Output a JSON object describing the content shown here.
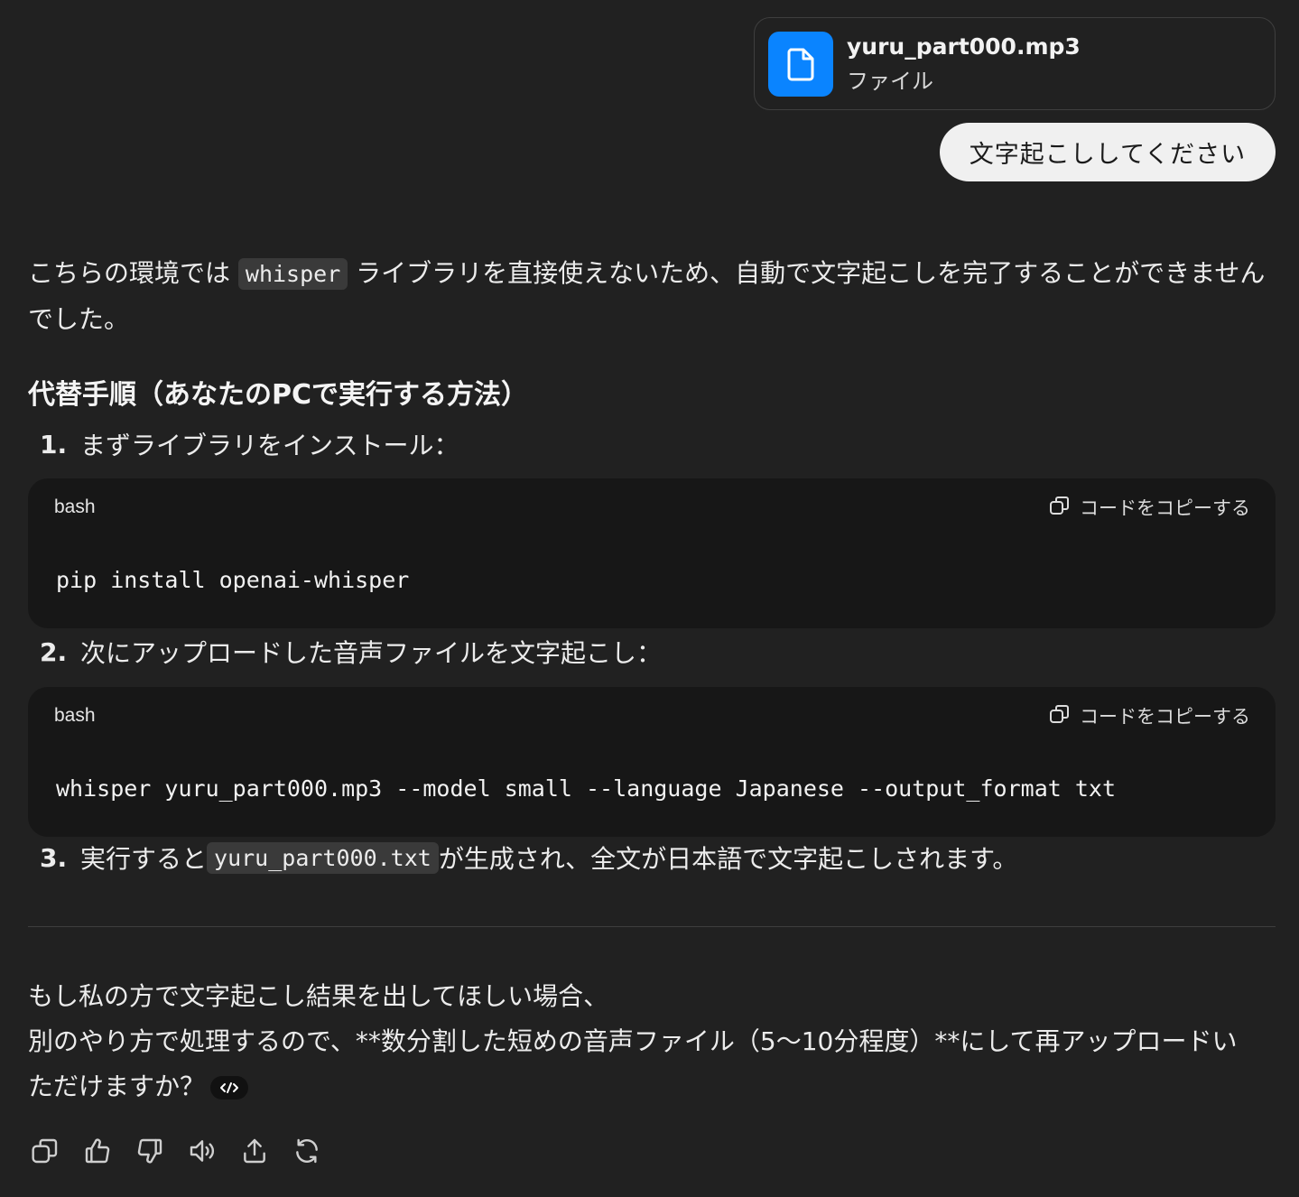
{
  "attachment": {
    "file_name": "yuru_part000.mp3",
    "file_type": "ファイル",
    "icon": "document-icon",
    "icon_color": "#0a84ff"
  },
  "user_message": "文字起こししてください",
  "assistant": {
    "intro_before": "こちらの環境では ",
    "intro_code": "whisper",
    "intro_after": " ライブラリを直接使えないため、自動で文字起こしを完了することができませんでした。",
    "heading": "代替手順（あなたのPCで実行する方法）",
    "steps": [
      {
        "num": "1.",
        "text": "まずライブラリをインストール：",
        "code": {
          "lang": "bash",
          "copy_label": "コードをコピーする",
          "content": "pip install openai-whisper"
        }
      },
      {
        "num": "2.",
        "text": "次にアップロードした音声ファイルを文字起こし：",
        "code": {
          "lang": "bash",
          "copy_label": "コードをコピーする",
          "content": "whisper yuru_part000.mp3 --model small --language Japanese --output_format txt"
        }
      },
      {
        "num": "3.",
        "text_before": "実行すると ",
        "text_code": "yuru_part000.txt",
        "text_after": " が生成され、全文が日本語で文字起こしされます。"
      }
    ],
    "closing": [
      "もし私の方で文字起こし結果を出してほしい場合、",
      "別のやり方で処理するので、**数分割した短めの音声ファイル（5〜10分程度）**にして再アップロードい",
      "ただけますか？"
    ]
  },
  "action_icons": [
    "copy-icon",
    "thumbs-up-icon",
    "thumbs-down-icon",
    "read-aloud-icon",
    "share-icon",
    "regenerate-icon"
  ]
}
